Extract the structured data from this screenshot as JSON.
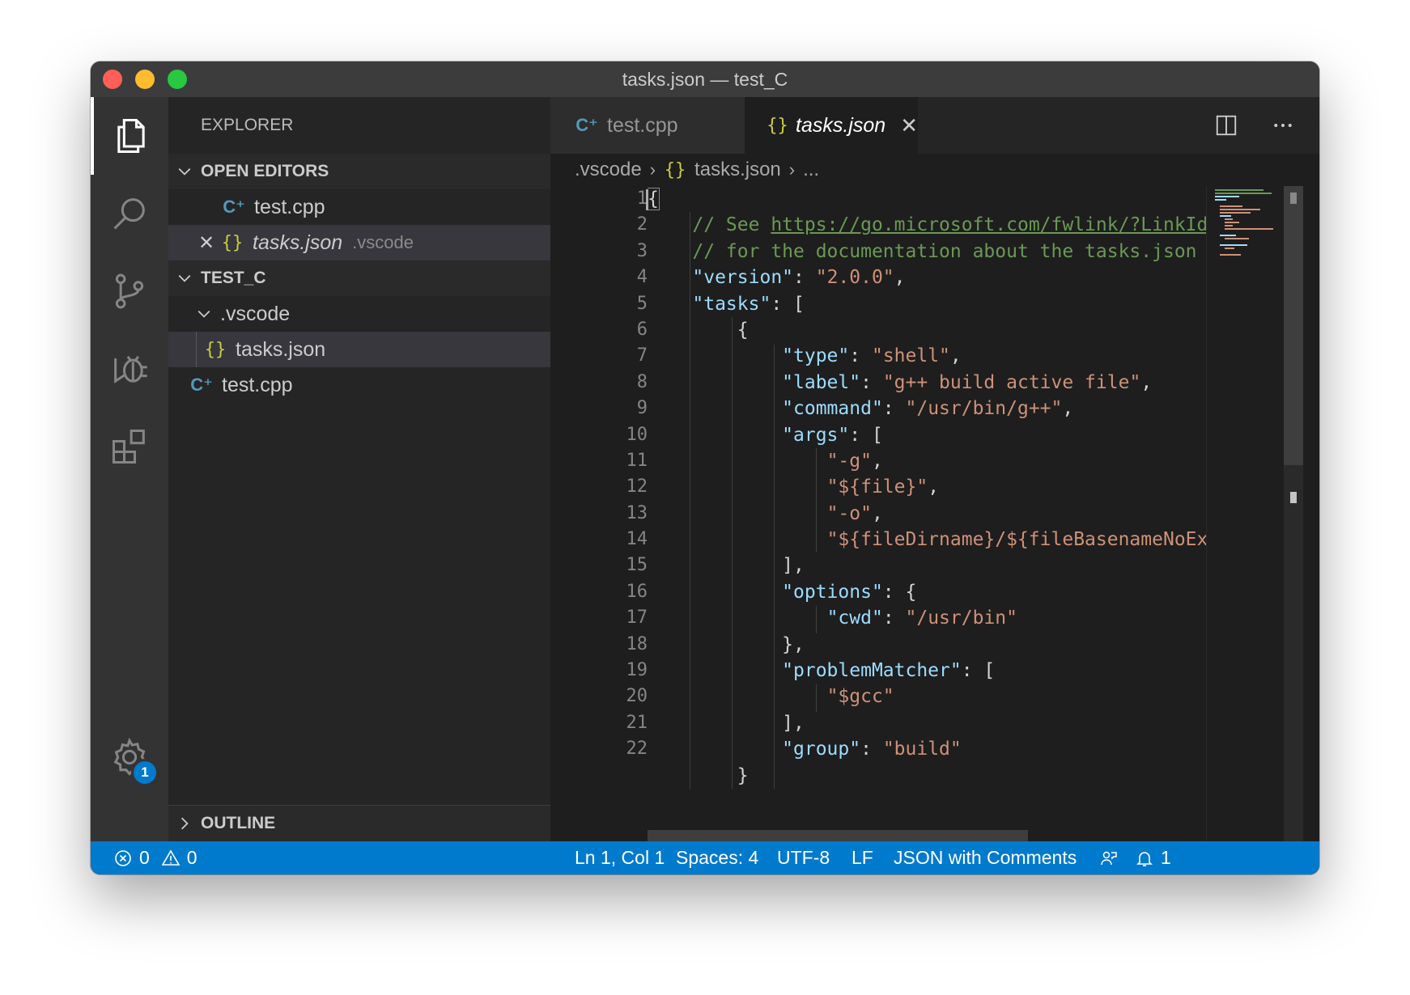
{
  "window": {
    "title": "tasks.json — test_C"
  },
  "explorer": {
    "header": "EXPLORER",
    "open_editors": {
      "label": "OPEN EDITORS",
      "items": [
        {
          "name": "test.cpp",
          "icon": "cpp-file-icon",
          "detail": ""
        },
        {
          "name": "tasks.json",
          "icon": "json-file-icon",
          "detail": ".vscode"
        }
      ]
    },
    "folder": {
      "label": "TEST_C",
      "subfolder": ".vscode",
      "subfolder_file": "tasks.json",
      "root_file": "test.cpp"
    },
    "outline_label": "OUTLINE"
  },
  "tabs": [
    {
      "label": "test.cpp",
      "icon": "cpp-file-icon",
      "active": false
    },
    {
      "label": "tasks.json",
      "icon": "json-file-icon",
      "active": true
    }
  ],
  "breadcrumbs": {
    "folder": ".vscode",
    "file": "tasks.json",
    "more": "..."
  },
  "editor": {
    "line_numbers": [
      "1",
      "2",
      "3",
      "4",
      "5",
      "6",
      "7",
      "8",
      "9",
      "10",
      "11",
      "12",
      "13",
      "14",
      "15",
      "16",
      "17",
      "18",
      "19",
      "20",
      "21",
      "22"
    ]
  },
  "statusbar": {
    "errors": "0",
    "warnings": "0",
    "cursor": "Ln 1, Col 1",
    "spaces": "Spaces: 4",
    "encoding": "UTF-8",
    "eol": "LF",
    "language": "JSON with Comments",
    "notifications": "1"
  },
  "settings_badge": "1",
  "colors": {
    "statusbar": "#007acc",
    "editor_bg": "#1e1e1e",
    "sidebar_bg": "#252526",
    "activity_bg": "#333333",
    "string": "#ce9178",
    "key": "#9cdcfe",
    "comment": "#6a9955"
  }
}
